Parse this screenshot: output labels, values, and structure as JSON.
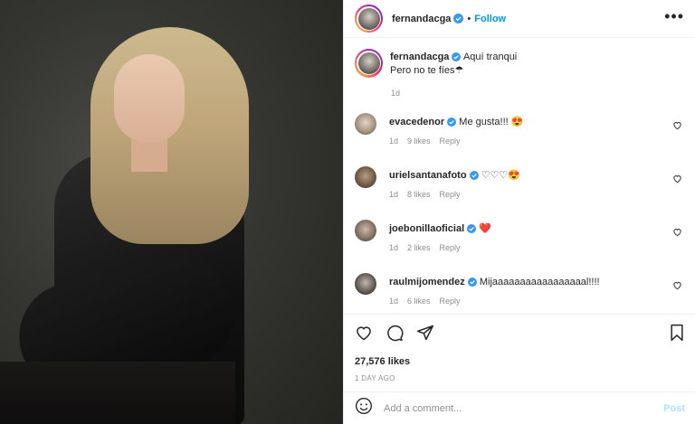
{
  "header": {
    "username": "fernandacga",
    "separator": "•",
    "follow_label": "Follow",
    "more_label": "•••"
  },
  "caption": {
    "username": "fernandacga",
    "line1": "Aquí tranqui",
    "line2": "Pero no te fíes☂",
    "time": "1d"
  },
  "comments": [
    {
      "username": "evacedenor",
      "text": "Me gusta!!! 😍",
      "time": "1d",
      "likes": "9 likes",
      "reply": "Reply"
    },
    {
      "username": "urielsantanafoto",
      "text": "♡♡♡😍",
      "time": "1d",
      "likes": "8 likes",
      "reply": "Reply"
    },
    {
      "username": "joebonillaoficial",
      "text": "❤️",
      "time": "1d",
      "likes": "2 likes",
      "reply": "Reply"
    },
    {
      "username": "raulmijomendez",
      "text": "Mijaaaaaaaaaaaaaaaaal!!!!",
      "time": "1d",
      "likes": "6 likes",
      "reply": "Reply"
    }
  ],
  "likes_count": "27,576 likes",
  "posted_ago": "1 DAY AGO",
  "add_comment": {
    "placeholder": "Add a comment...",
    "post_label": "Post"
  },
  "colors": {
    "accent": "#0095f6",
    "verified": "#3897f0",
    "muted": "#8e8e8e",
    "heart_red": "#ed4956"
  },
  "icons": [
    "verified-badge-icon",
    "more-options-icon",
    "heart-icon",
    "comment-icon",
    "share-icon",
    "bookmark-icon",
    "emoji-icon"
  ]
}
